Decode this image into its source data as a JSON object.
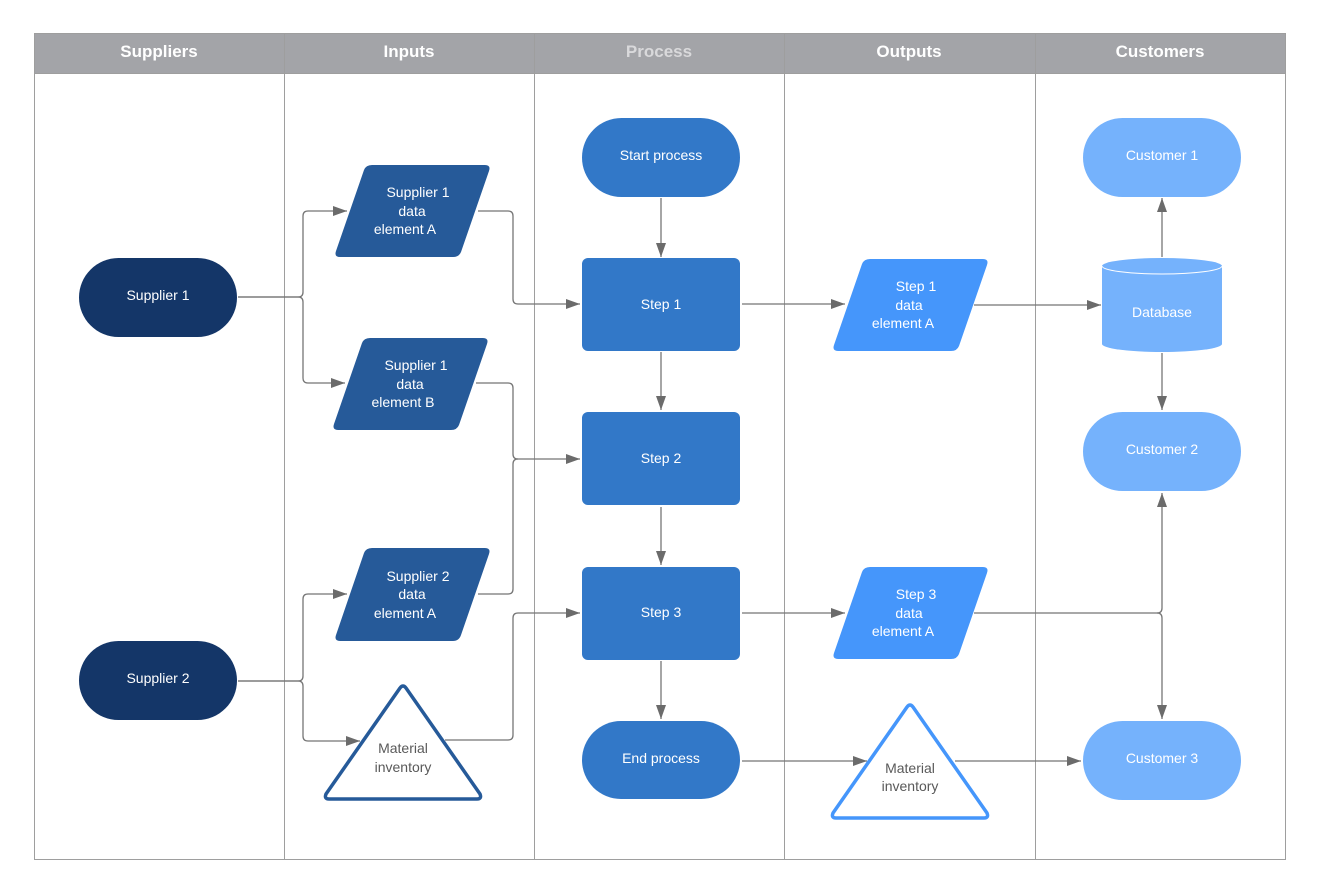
{
  "diagram": {
    "type": "SIPOC swimlane flowchart",
    "colors": {
      "header_bg": "#a3a4a8",
      "supplier_fill": "#143668",
      "input_fill": "#265a99",
      "process_fill": "#3278c8",
      "output_fill": "#4596fb",
      "customer_fill": "#75b2fc",
      "connector": "#6b6b6b",
      "lane_border": "#9e9e9e"
    },
    "lanes": [
      {
        "id": "suppliers",
        "title": "Suppliers"
      },
      {
        "id": "inputs",
        "title": "Inputs"
      },
      {
        "id": "process",
        "title": "Process"
      },
      {
        "id": "outputs",
        "title": "Outputs"
      },
      {
        "id": "customers",
        "title": "Customers"
      }
    ],
    "nodes": {
      "supplier1": {
        "lane": "suppliers",
        "shape": "terminator",
        "lines": [
          "Supplier 1"
        ]
      },
      "supplier2": {
        "lane": "suppliers",
        "shape": "terminator",
        "lines": [
          "Supplier 2"
        ]
      },
      "s1a": {
        "lane": "inputs",
        "shape": "data",
        "lines": [
          "Supplier 1",
          "data",
          "element A"
        ]
      },
      "s1b": {
        "lane": "inputs",
        "shape": "data",
        "lines": [
          "Supplier 1",
          "data",
          "element B"
        ]
      },
      "s2a": {
        "lane": "inputs",
        "shape": "data",
        "lines": [
          "Supplier 2",
          "data",
          "element A"
        ]
      },
      "inv_in": {
        "lane": "inputs",
        "shape": "triangle",
        "lines": [
          "Material",
          "inventory"
        ]
      },
      "start": {
        "lane": "process",
        "shape": "terminator",
        "lines": [
          "Start process"
        ]
      },
      "step1": {
        "lane": "process",
        "shape": "process",
        "lines": [
          "Step 1"
        ]
      },
      "step2": {
        "lane": "process",
        "shape": "process",
        "lines": [
          "Step 2"
        ]
      },
      "step3": {
        "lane": "process",
        "shape": "process",
        "lines": [
          "Step 3"
        ]
      },
      "end": {
        "lane": "process",
        "shape": "terminator",
        "lines": [
          "End process"
        ]
      },
      "o1": {
        "lane": "outputs",
        "shape": "data",
        "lines": [
          "Step 1",
          "data",
          "element A"
        ]
      },
      "o3": {
        "lane": "outputs",
        "shape": "data",
        "lines": [
          "Step 3",
          "data",
          "element A"
        ]
      },
      "inv_out": {
        "lane": "outputs",
        "shape": "triangle",
        "lines": [
          "Material",
          "inventory"
        ]
      },
      "c1": {
        "lane": "customers",
        "shape": "terminator",
        "lines": [
          "Customer 1"
        ]
      },
      "db": {
        "lane": "customers",
        "shape": "database",
        "lines": [
          "Database"
        ]
      },
      "c2": {
        "lane": "customers",
        "shape": "terminator",
        "lines": [
          "Customer 2"
        ]
      },
      "c3": {
        "lane": "customers",
        "shape": "terminator",
        "lines": [
          "Customer 3"
        ]
      }
    },
    "edges": [
      {
        "from": "supplier1",
        "to": "s1a"
      },
      {
        "from": "supplier1",
        "to": "s1b"
      },
      {
        "from": "supplier2",
        "to": "s2a"
      },
      {
        "from": "supplier2",
        "to": "inv_in"
      },
      {
        "from": "s1a",
        "to": "step1"
      },
      {
        "from": "s1b",
        "to": "step2"
      },
      {
        "from": "s2a",
        "to": "step2"
      },
      {
        "from": "inv_in",
        "to": "step3"
      },
      {
        "from": "start",
        "to": "step1"
      },
      {
        "from": "step1",
        "to": "step2"
      },
      {
        "from": "step2",
        "to": "step3"
      },
      {
        "from": "step3",
        "to": "end"
      },
      {
        "from": "step1",
        "to": "o1"
      },
      {
        "from": "step3",
        "to": "o3"
      },
      {
        "from": "end",
        "to": "inv_out"
      },
      {
        "from": "o1",
        "to": "db"
      },
      {
        "from": "db",
        "to": "c1"
      },
      {
        "from": "db",
        "to": "c2"
      },
      {
        "from": "o3",
        "to": "c2"
      },
      {
        "from": "o3",
        "to": "c3"
      },
      {
        "from": "inv_out",
        "to": "c3"
      }
    ]
  }
}
